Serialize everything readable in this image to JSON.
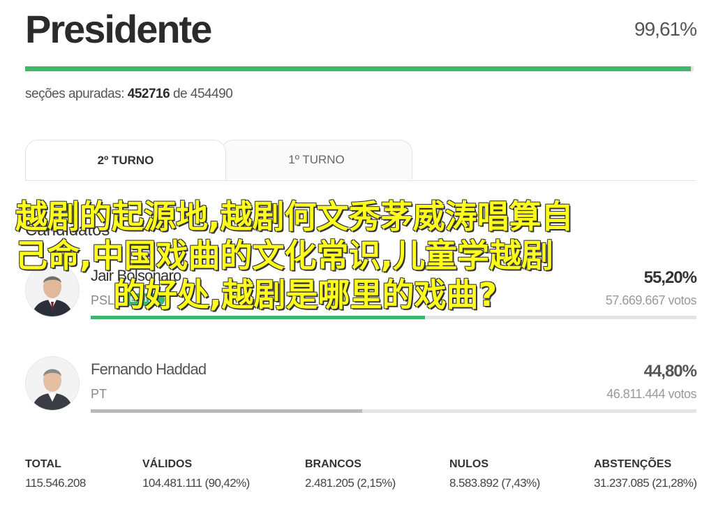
{
  "header": {
    "title": "Presidente",
    "percent": "99,61%",
    "progress": 0.9961
  },
  "sections": {
    "label": "seções apuradas:",
    "counted": "452716",
    "of": "de",
    "total": "454490"
  },
  "tabs": [
    {
      "label": "2º TURNO",
      "active": true
    },
    {
      "label": "1º TURNO",
      "active": false
    }
  ],
  "candidates_label": "Candidatos",
  "candidates": [
    {
      "name": "Jair Bolsonaro",
      "party": "PSL",
      "badge": "ELEITO",
      "percent": "55,20%",
      "votes": "57.669.667 votos",
      "share": 0.552,
      "bar_color": "#3db86b"
    },
    {
      "name": "Fernando Haddad",
      "party": "PT",
      "percent": "44,80%",
      "votes": "46.811.444 votos",
      "share": 0.448,
      "bar_color": "#b9b9b9"
    }
  ],
  "totals": [
    {
      "label": "TOTAL",
      "value": "115.546.208"
    },
    {
      "label": "VÁLIDOS",
      "value": "104.481.111 (90,42%)"
    },
    {
      "label": "BRANCOS",
      "value": "2.481.205 (2,15%)"
    },
    {
      "label": "NULOS",
      "value": "8.583.892 (7,43%)"
    },
    {
      "label": "ABSTENÇÕES",
      "value": "31.237.085 (21,28%)"
    }
  ],
  "overlay": {
    "line1": "越剧的起源地,越剧何文秀茅威涛唱算自",
    "line2": "己命,中国戏曲的文化常识,儿童学越剧",
    "line3": "的好处,越剧是哪里的戏曲?"
  },
  "colors": {
    "accent": "#3db86b",
    "overlay_text": "#ffff1a"
  }
}
